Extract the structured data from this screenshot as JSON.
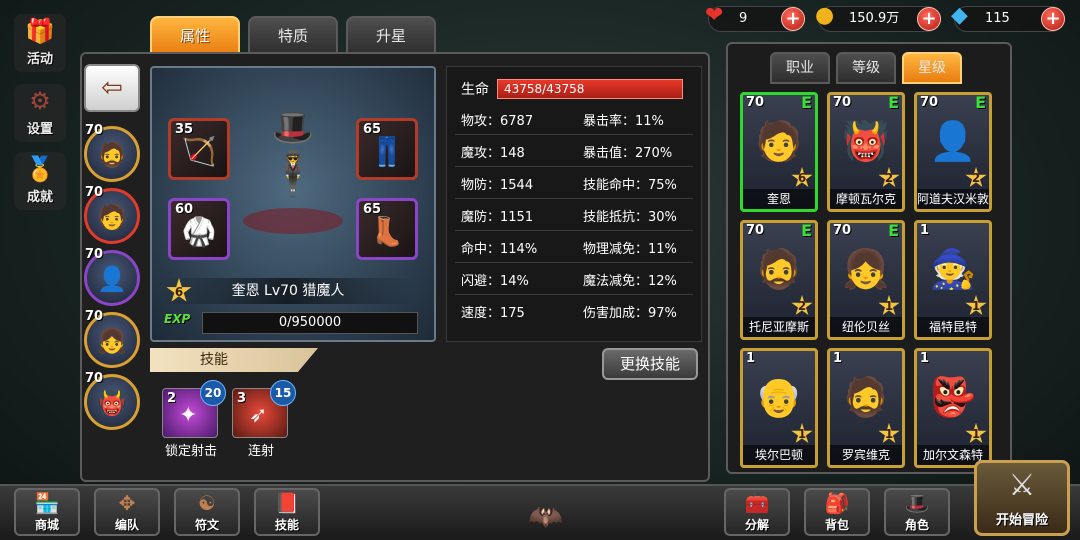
{
  "side_menu": [
    {
      "label": "活动",
      "icon": "gift-icon"
    },
    {
      "label": "设置",
      "icon": "gear-icon"
    },
    {
      "label": "成就",
      "icon": "medal-icon"
    }
  ],
  "tabs": {
    "attributes": "属性",
    "traits": "特质",
    "ascend": "升星"
  },
  "resources": {
    "hearts": "9",
    "gold": "150.9万",
    "gems": "115"
  },
  "left_heroes": [
    "70",
    "70",
    "70",
    "70",
    "70"
  ],
  "equipment": [
    {
      "level": "35",
      "icon": "crossbow-icon"
    },
    {
      "level": "65",
      "icon": "pants-icon"
    },
    {
      "level": "60",
      "icon": "armor-icon"
    },
    {
      "level": "65",
      "icon": "boots-icon"
    }
  ],
  "hero": {
    "star": "6",
    "name_line": "奎恩  Lv70  猎魔人",
    "exp": "0/950000"
  },
  "stats": {
    "hp_label": "生命",
    "hp_value": "43758/43758",
    "rows": [
      [
        "物攻：6787",
        "暴击率：11%"
      ],
      [
        "魔攻：148",
        "暴击值：270%"
      ],
      [
        "物防：1544",
        "技能命中：75%"
      ],
      [
        "魔防：1151",
        "技能抵抗：30%"
      ],
      [
        "命中：114%",
        "物理减免：11%"
      ],
      [
        "闪避：14%",
        "魔法减免：12%"
      ],
      [
        "速度：175",
        "伤害加成：97%"
      ]
    ]
  },
  "skills": {
    "header": "技能",
    "change_button": "更换技能",
    "items": [
      {
        "name": "锁定射击",
        "level": "2",
        "cost": "20"
      },
      {
        "name": "连射",
        "level": "3",
        "cost": "15"
      }
    ]
  },
  "sort_tabs": {
    "class": "职业",
    "level": "等级",
    "star": "星级"
  },
  "cards": [
    {
      "level": "70",
      "e": "E",
      "star": "6",
      "name": "奎恩"
    },
    {
      "level": "70",
      "e": "E",
      "star": "2",
      "name": "摩顿瓦尔克"
    },
    {
      "level": "70",
      "e": "E",
      "star": "2",
      "name": "阿道夫汉米敦"
    },
    {
      "level": "70",
      "e": "E",
      "star": "2",
      "name": "托尼亚摩斯"
    },
    {
      "level": "70",
      "e": "E",
      "star": "1",
      "name": "纽伦贝丝"
    },
    {
      "level": "1",
      "e": "",
      "star": "1",
      "name": "福特昆特"
    },
    {
      "level": "1",
      "e": "",
      "star": "1",
      "name": "埃尔巴顿"
    },
    {
      "level": "1",
      "e": "",
      "star": "1",
      "name": "罗宾维克"
    },
    {
      "level": "1",
      "e": "",
      "star": "1",
      "name": "加尔文森特"
    }
  ],
  "bottom": {
    "shop": "商城",
    "formation": "编队",
    "runes": "符文",
    "skills": "技能",
    "decompose": "分解",
    "bag": "背包",
    "role": "角色",
    "start": "开始冒险"
  }
}
